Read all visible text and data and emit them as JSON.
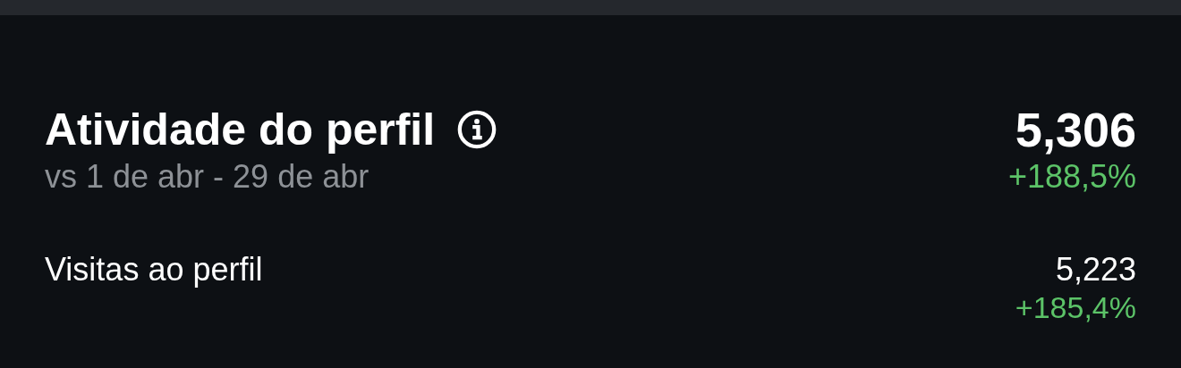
{
  "header": {
    "title": "Atividade do perfil",
    "subtitle": "vs 1 de abr - 29 de abr",
    "value": "5,306",
    "change": "+188,5%",
    "color": "#5cc368"
  },
  "rows": [
    {
      "label": "Visitas ao perfil",
      "value": "5,223",
      "change": "+185,4%",
      "color": "#5cc368"
    }
  ]
}
